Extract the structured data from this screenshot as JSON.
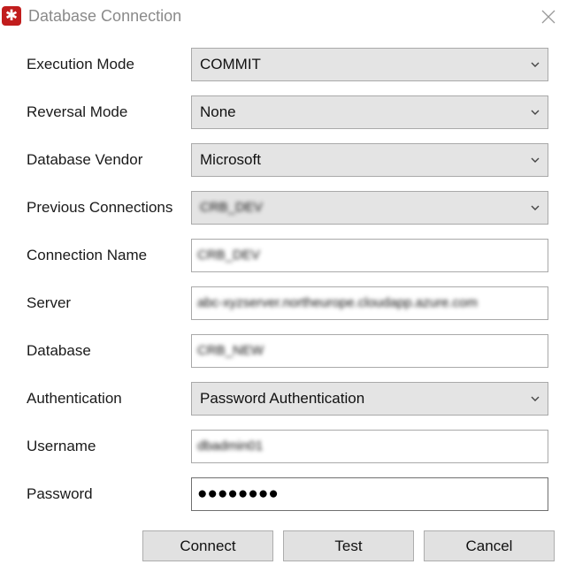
{
  "window": {
    "title": "Database Connection",
    "icon": "app-star-icon",
    "accent": "#c11d1d"
  },
  "form": {
    "execution_mode": {
      "label": "Execution Mode",
      "value": "COMMIT"
    },
    "reversal_mode": {
      "label": "Reversal Mode",
      "value": "None"
    },
    "database_vendor": {
      "label": "Database Vendor",
      "value": "Microsoft"
    },
    "previous_connections": {
      "label": "Previous Connections",
      "value": "CRB_DEV"
    },
    "connection_name": {
      "label": "Connection Name",
      "value": "CRB_DEV"
    },
    "server": {
      "label": "Server",
      "value": "abc-xyzserver.northeurope.cloudapp.azure.com"
    },
    "database": {
      "label": "Database",
      "value": "CRB_NEW"
    },
    "authentication": {
      "label": "Authentication",
      "value": "Password Authentication"
    },
    "username": {
      "label": "Username",
      "value": "dbadmin01"
    },
    "password": {
      "label": "Password",
      "value": "●●●●●●●●"
    }
  },
  "buttons": {
    "connect": "Connect",
    "test": "Test",
    "cancel": "Cancel"
  }
}
